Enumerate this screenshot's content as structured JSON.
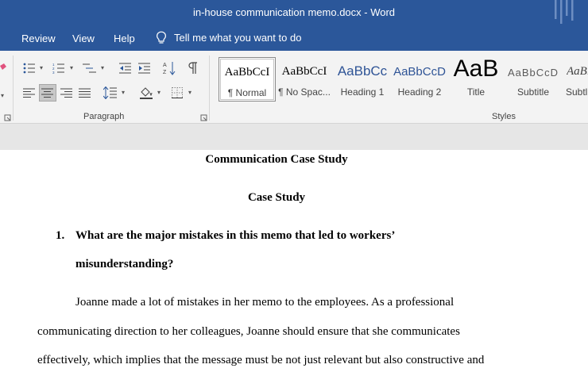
{
  "window": {
    "title": "in-house communication memo.docx  -  Word"
  },
  "menu": {
    "tabs": [
      {
        "label": "Review"
      },
      {
        "label": "View"
      },
      {
        "label": "Help"
      }
    ],
    "tell_me": "Tell me what you want to do"
  },
  "ribbon": {
    "groups": {
      "paragraph": {
        "label": "Paragraph"
      },
      "styles": {
        "label": "Styles"
      }
    },
    "styles": [
      {
        "sample": "AaBbCcI",
        "name": "¶ Normal"
      },
      {
        "sample": "AaBbCcI",
        "name": "¶ No Spac..."
      },
      {
        "sample": "AaBbCc",
        "name": "Heading 1"
      },
      {
        "sample": "AaBbCcD",
        "name": "Heading 2"
      },
      {
        "sample": "AaB",
        "name": "Title"
      },
      {
        "sample": "AaBbCcD",
        "name": "Subtitle"
      },
      {
        "sample": "AaBl",
        "name": "Subtl"
      }
    ],
    "colors": {
      "accent": "#2b579a",
      "heading": "#2f5496"
    }
  },
  "document": {
    "heading": "Communication Case Study",
    "subheading": "Case Study",
    "question_number": "1.",
    "question_line1": "What are the major mistakes in this memo that led to workers’",
    "question_line2": "misunderstanding?",
    "body_line1": "Joanne made a lot of mistakes in her memo to the employees. As a professional",
    "body_line2": "communicating direction to her colleagues, Joanne should ensure that she communicates",
    "body_line3": "effectively, which implies that the message must be not just relevant but also constructive and"
  }
}
